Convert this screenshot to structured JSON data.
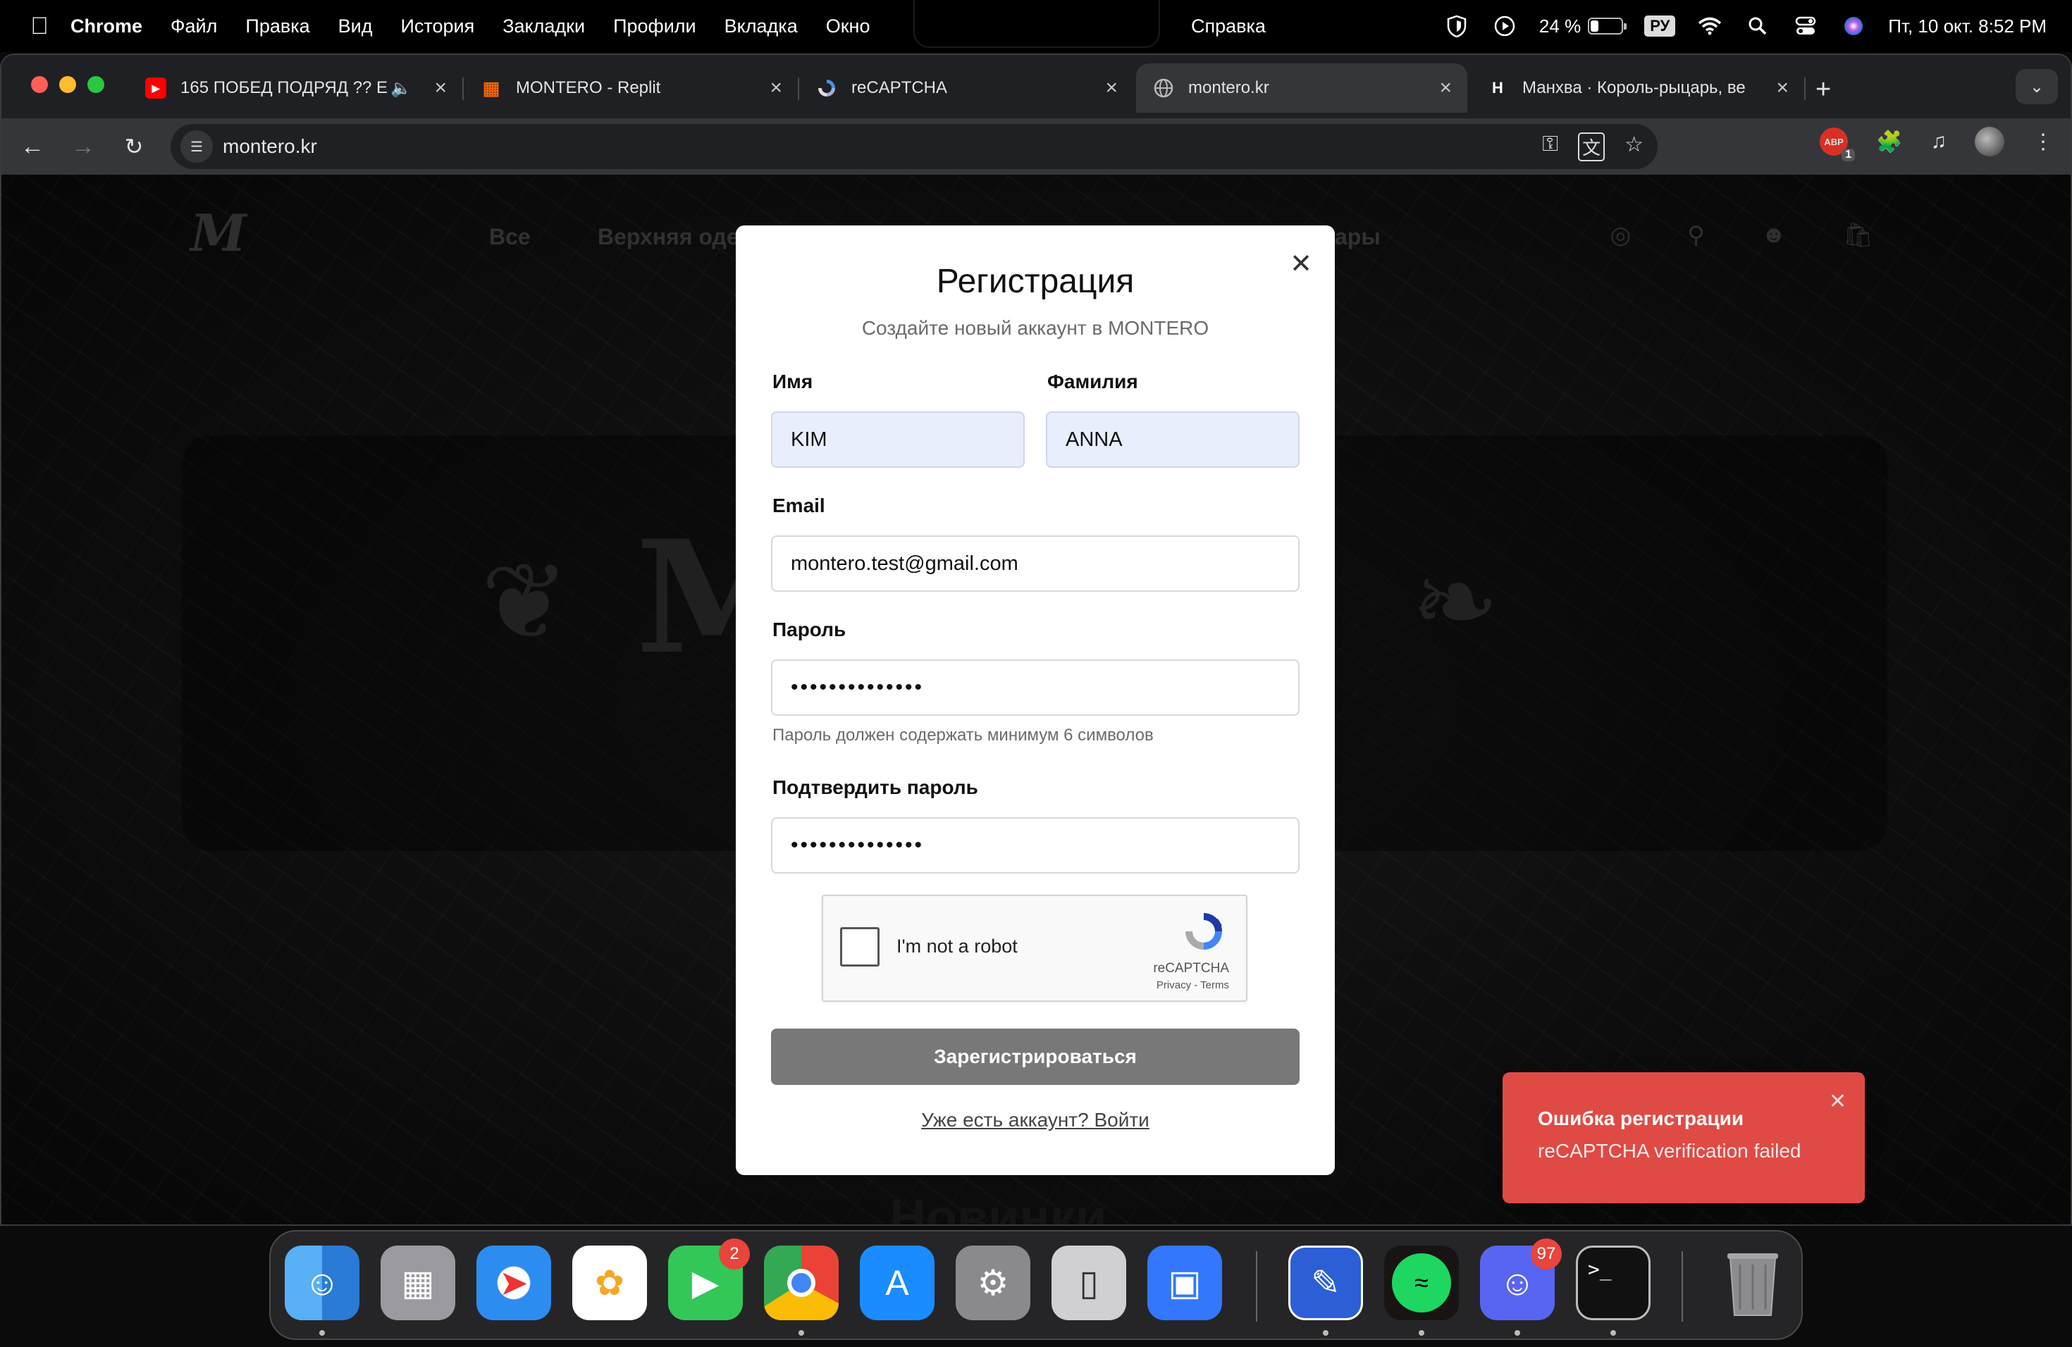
{
  "menubar": {
    "app": "Chrome",
    "items": [
      "Файл",
      "Правка",
      "Вид",
      "История",
      "Закладки",
      "Профили",
      "Вкладка",
      "Окно"
    ],
    "help": "Справка",
    "battery_pct": "24 %",
    "battery_level": 0.24,
    "lang": "РУ",
    "datetime": "Пт, 10 окт.  8:52 PM"
  },
  "tabs": [
    {
      "title": "165 ПОБЕД ПОДРЯД ?? Е",
      "favicon": "youtube-icon"
    },
    {
      "title": "MONTERO - Replit",
      "favicon": "replit-icon"
    },
    {
      "title": "reCAPTCHA",
      "favicon": "recaptcha-icon"
    },
    {
      "title": "montero.kr",
      "favicon": "globe-icon"
    },
    {
      "title": "Манхва · Король-рыцарь, ве",
      "favicon": "manhwa-icon"
    }
  ],
  "address": {
    "url": "montero.kr"
  },
  "extension_badge": "1",
  "site": {
    "logo": "M",
    "nav": [
      "Все",
      "Верхняя оде",
      "ары"
    ],
    "hero_word": "M       o",
    "section": "Новинки"
  },
  "modal": {
    "title": "Регистрация",
    "subtitle": "Создайте новый аккаунт в MONTERO",
    "first_name_label": "Имя",
    "first_name_value": "KIM",
    "last_name_label": "Фамилия",
    "last_name_value": "ANNA",
    "email_label": "Email",
    "email_value": "montero.test@gmail.com",
    "password_label": "Пароль",
    "password_value": "••••••••••••••",
    "password_hint": "Пароль должен содержать минимум 6 символов",
    "confirm_label": "Подтвердить пароль",
    "confirm_value": "••••••••••••••",
    "submit": "Зарегистрироваться",
    "login_link": "Уже есть аккаунт? Войти"
  },
  "captcha": {
    "label": "I'm not a robot",
    "brand": "reCAPTCHA",
    "terms": "Privacy - Terms"
  },
  "toast": {
    "title": "Ошибка регистрации",
    "message": "reCAPTCHA verification failed"
  },
  "dock": {
    "facetime_badge": "2",
    "discord_badge": "97"
  },
  "colors": {
    "toast_bg": "#e04a45",
    "submit_bg": "#787878",
    "autofill_bg": "#e8eefc"
  }
}
